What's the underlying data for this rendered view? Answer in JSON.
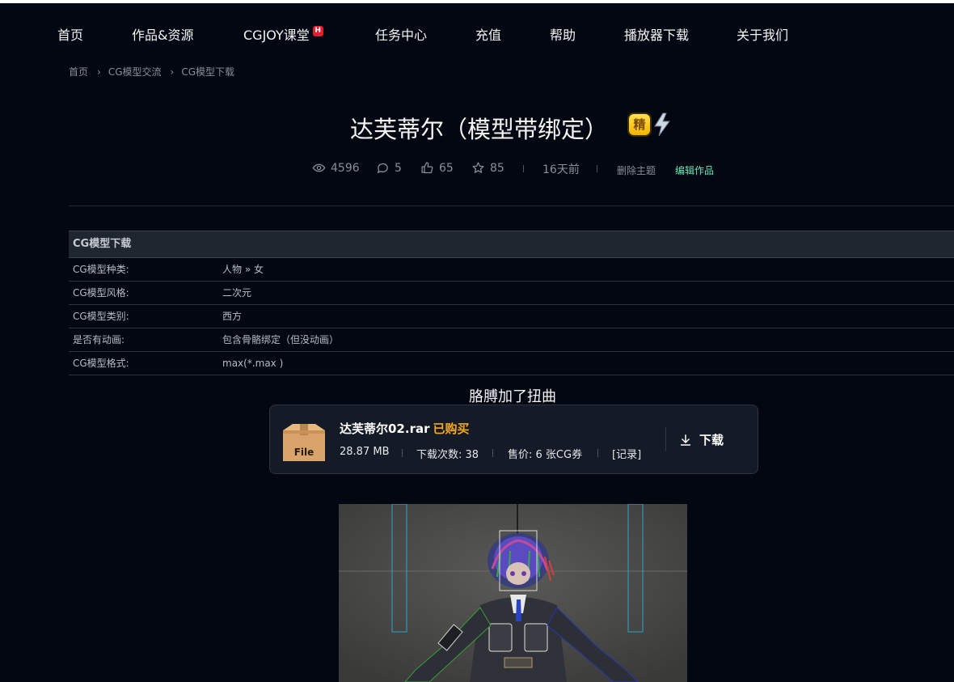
{
  "nav": {
    "items": [
      {
        "label": "首页"
      },
      {
        "label": "作品&资源"
      },
      {
        "label": "CGJOY课堂",
        "badge": "H"
      },
      {
        "label": "任务中心"
      },
      {
        "label": "充值"
      },
      {
        "label": "帮助"
      },
      {
        "label": "播放器下载"
      },
      {
        "label": "关于我们"
      }
    ]
  },
  "breadcrumb": {
    "items": [
      "首页",
      "CG模型交流",
      "CG模型下载"
    ],
    "separator": "›"
  },
  "post": {
    "title": "达芙蒂尔（模型带绑定）",
    "badge": "精",
    "stats": {
      "views": "4596",
      "comments": "5",
      "likes": "65",
      "favorites": "85",
      "time": "16天前"
    },
    "actions": {
      "delete": "删除主题",
      "edit": "编辑作品"
    },
    "colors": {
      "edit": "#6ee7b7",
      "bought": "#f5a623",
      "hot": "#e11d2e"
    }
  },
  "spec_table": {
    "header": "CG模型下载",
    "rows": [
      {
        "key": "CG模型种类:",
        "value": "人物 » 女"
      },
      {
        "key": "CG模型风格:",
        "value": "二次元"
      },
      {
        "key": "CG模型类别:",
        "value": "西方"
      },
      {
        "key": "是否有动画:",
        "value": "包含骨骼绑定（但没动画）"
      },
      {
        "key": "CG模型格式:",
        "value": "max(*.max )"
      }
    ]
  },
  "content": {
    "caption": "胳膊加了扭曲"
  },
  "attachment": {
    "icon_text": "File",
    "filename": "达芙蒂尔02.rar",
    "status": "已购买",
    "size": "28.87 MB",
    "downloads": "下载次数: 38",
    "price": "售价: 6 张CG券",
    "record": "[记录]",
    "download_label": "下载"
  }
}
